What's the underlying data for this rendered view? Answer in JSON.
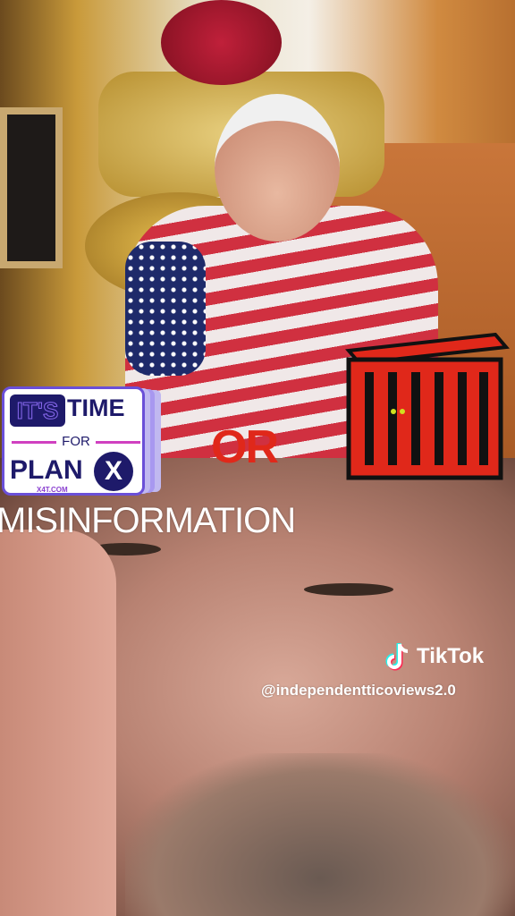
{
  "sticker": {
    "its": "IT'S",
    "time": "TIME",
    "for": "FOR",
    "plan": "PLAN",
    "x": "X",
    "url": "X4T.COM"
  },
  "overlay": {
    "or": "OR",
    "caption": "MISINFORMATION"
  },
  "watermark": {
    "brand": "TikTok",
    "handle": "@independentticoviews2.0"
  },
  "colors": {
    "or_red": "#e0281a",
    "sticker_navy": "#1e1a6a",
    "accent_pink": "#d040c0"
  }
}
